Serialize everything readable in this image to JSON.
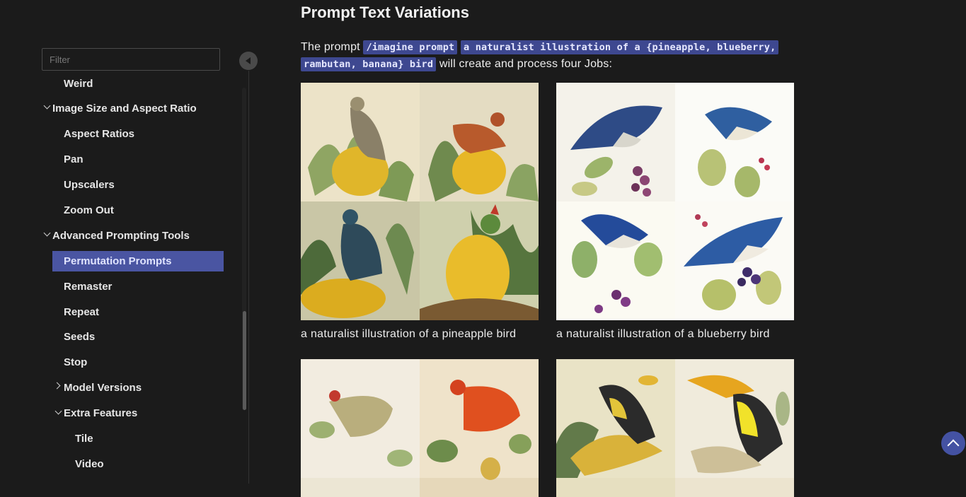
{
  "sidebar": {
    "filter_placeholder": "Filter",
    "items": [
      {
        "label": "Weird"
      },
      {
        "label": "Image Size and Aspect Ratio"
      },
      {
        "label": "Aspect Ratios"
      },
      {
        "label": "Pan"
      },
      {
        "label": "Upscalers"
      },
      {
        "label": "Zoom Out"
      },
      {
        "label": "Advanced Prompting Tools"
      },
      {
        "label": "Permutation Prompts"
      },
      {
        "label": "Remaster"
      },
      {
        "label": "Repeat"
      },
      {
        "label": "Seeds"
      },
      {
        "label": "Stop"
      },
      {
        "label": "Model Versions"
      },
      {
        "label": "Extra Features"
      },
      {
        "label": "Tile"
      },
      {
        "label": "Video"
      }
    ]
  },
  "main": {
    "title": "Prompt Text Variations",
    "para_before": "The prompt ",
    "code1": "/imagine prompt",
    "code2a": "a naturalist illustration of a {pineapple, blueberry,",
    "code2b": "rambutan, banana} bird",
    "para_after": " will create and process four Jobs:",
    "captions": [
      "a naturalist illustration of a pineapple bird",
      "a naturalist illustration of a blueberry bird"
    ]
  },
  "colors": {
    "active_bg": "#4a55a2",
    "code_bg": "#3e4890",
    "scroll_top_bg": "#4452a3"
  }
}
